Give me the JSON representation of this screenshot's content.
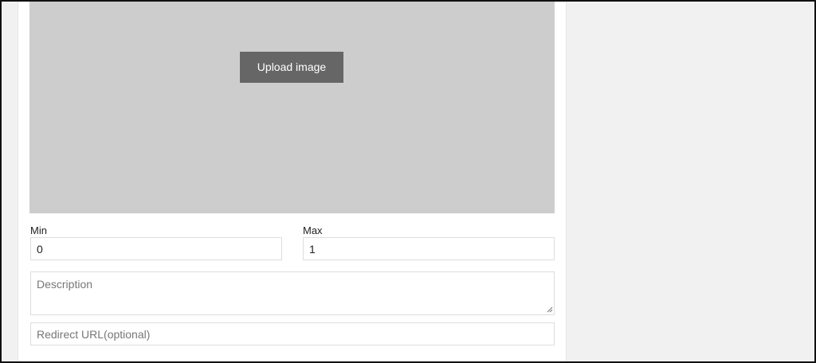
{
  "upload": {
    "button_label": "Upload image"
  },
  "fields": {
    "min": {
      "label": "Min",
      "value": "0"
    },
    "max": {
      "label": "Max",
      "value": "1"
    },
    "description": {
      "placeholder": "Description"
    },
    "redirect_url": {
      "placeholder": "Redirect URL(optional)"
    }
  },
  "colors": {
    "upload_area": "#cdcdcd",
    "upload_button": "#666666",
    "outer_background": "#f1f1f1"
  }
}
